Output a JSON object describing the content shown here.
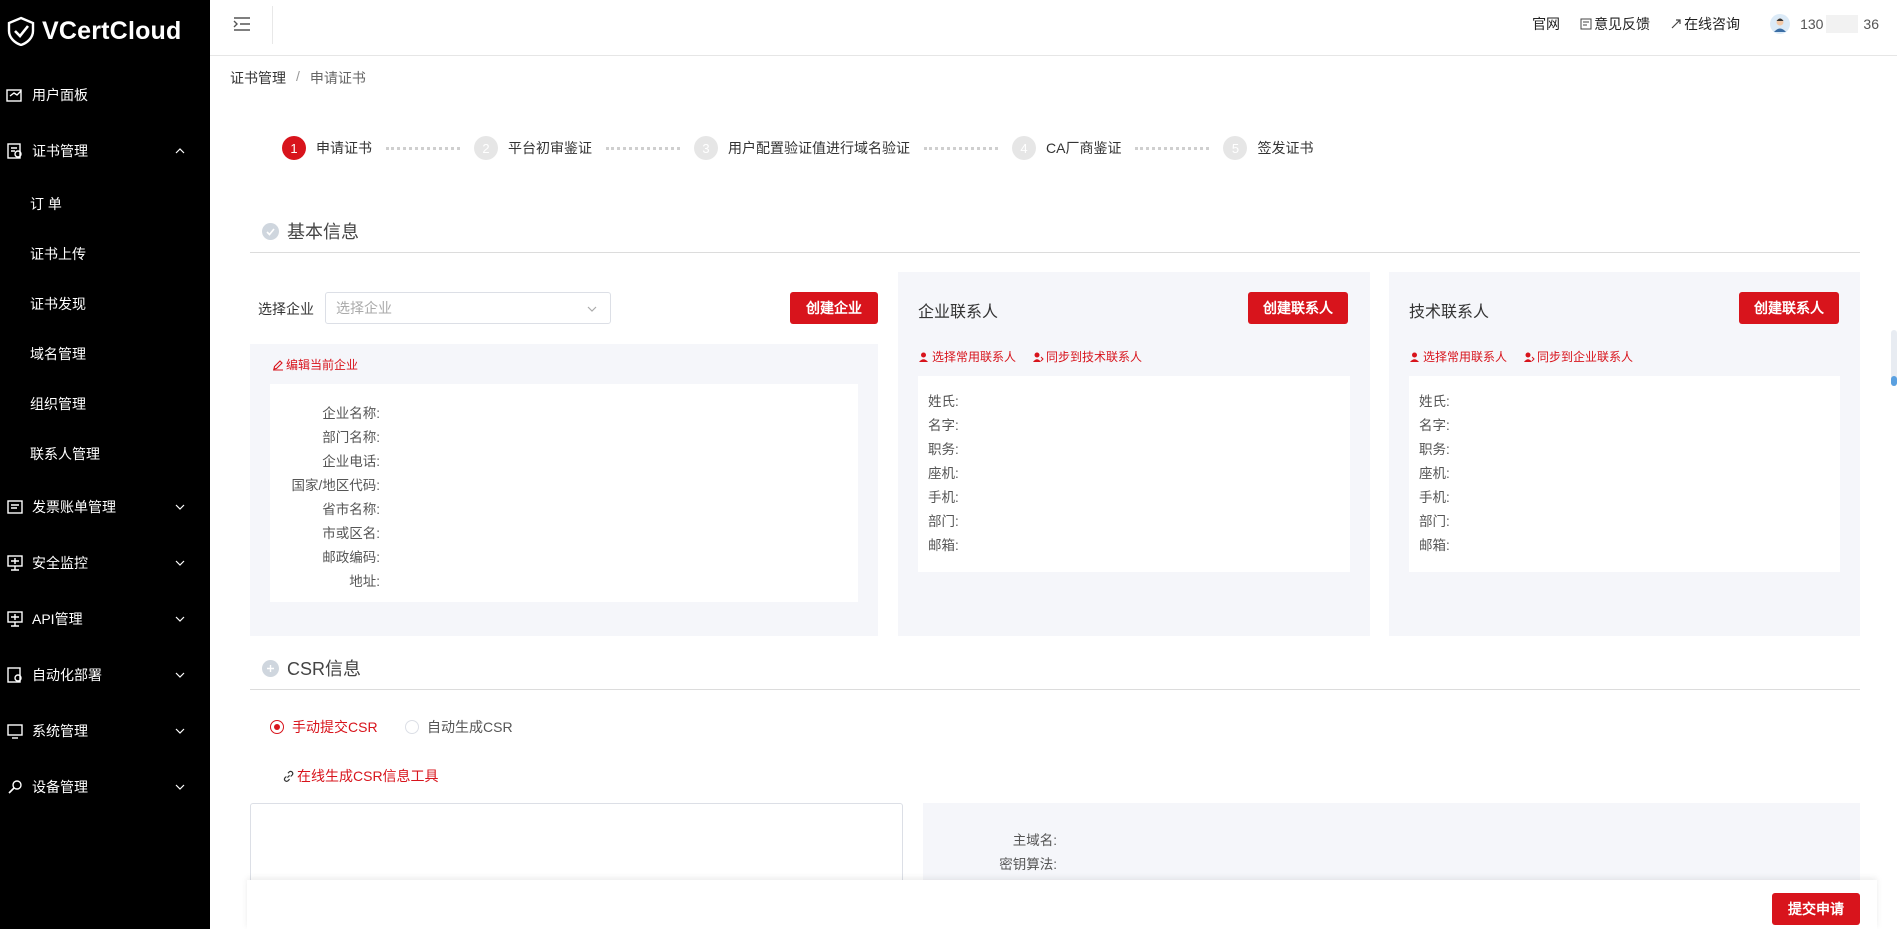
{
  "app": {
    "name": "VCertCloud"
  },
  "sidebar": {
    "items": [
      {
        "label": "用户面板",
        "icon": "dashboard-icon"
      },
      {
        "label": "证书管理",
        "icon": "certificate-icon",
        "expanded": true,
        "children": [
          "订 单",
          "证书上传",
          "证书发现",
          "域名管理",
          "组织管理",
          "联系人管理"
        ]
      },
      {
        "label": "发票账单管理",
        "icon": "invoice-icon"
      },
      {
        "label": "安全监控",
        "icon": "monitor-icon"
      },
      {
        "label": "API管理",
        "icon": "api-icon"
      },
      {
        "label": "自动化部署",
        "icon": "deploy-icon"
      },
      {
        "label": "系统管理",
        "icon": "system-icon"
      },
      {
        "label": "设备管理",
        "icon": "device-icon"
      }
    ]
  },
  "header": {
    "links": [
      "官网",
      "意见反馈",
      "在线咨询"
    ],
    "user_phone_prefix": "130",
    "user_phone_suffix": "36"
  },
  "breadcrumb": {
    "parent": "证书管理",
    "separator": "/",
    "current": "申请证书"
  },
  "steps": [
    {
      "num": "1",
      "label": "申请证书",
      "active": true
    },
    {
      "num": "2",
      "label": "平台初审鉴证"
    },
    {
      "num": "3",
      "label": "用户配置验证值进行域名验证"
    },
    {
      "num": "4",
      "label": "CA厂商鉴证"
    },
    {
      "num": "5",
      "label": "签发证书"
    }
  ],
  "basic_info": {
    "title": "基本信息",
    "select_label": "选择企业",
    "select_placeholder": "选择企业",
    "create_company": "创建企业",
    "edit_company": "编辑当前企业",
    "company_fields": [
      "企业名称:",
      "部门名称:",
      "企业电话:",
      "国家/地区代码:",
      "省市名称:",
      "市或区名:",
      "邮政编码:",
      "地址:"
    ]
  },
  "business_contact": {
    "title": "企业联系人",
    "create": "创建联系人",
    "choose": "选择常用联系人",
    "sync": "同步到技术联系人",
    "fields": [
      "姓氏:",
      "名字:",
      "职务:",
      "座机:",
      "手机:",
      "部门:",
      "邮箱:"
    ]
  },
  "tech_contact": {
    "title": "技术联系人",
    "create": "创建联系人",
    "choose": "选择常用联系人",
    "sync": "同步到企业联系人",
    "fields": [
      "姓氏:",
      "名字:",
      "职务:",
      "座机:",
      "手机:",
      "部门:",
      "邮箱:"
    ]
  },
  "csr": {
    "title": "CSR信息",
    "manual": "手动提交CSR",
    "auto": "自动生成CSR",
    "selected": "manual",
    "tool_link": "在线生成CSR信息工具",
    "info_fields": [
      "主域名:",
      "密钥算法:"
    ]
  },
  "footer": {
    "submit": "提交申请"
  },
  "colors": {
    "accent": "#d8141c",
    "sidebar_bg": "#000000",
    "panel_bg": "#f5f6fa"
  }
}
